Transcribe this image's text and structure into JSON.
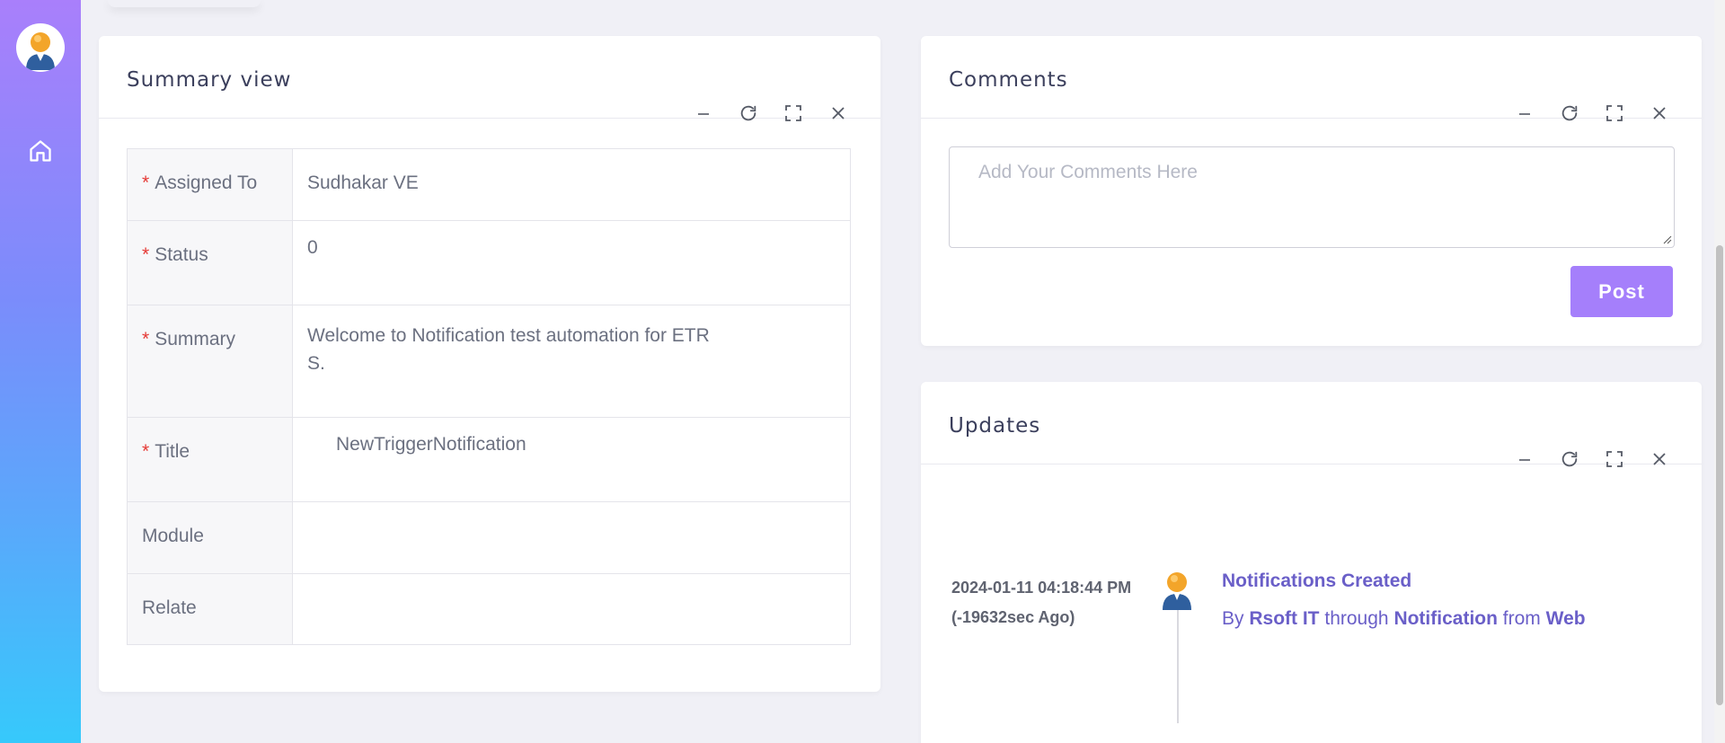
{
  "sidebar": {
    "avatar_icon": "user-avatar-icon",
    "nav": [
      {
        "icon": "home-icon"
      }
    ]
  },
  "summary": {
    "title": "Summary view",
    "fields": [
      {
        "label": "Assigned To",
        "required": true,
        "value": "Sudhakar VE"
      },
      {
        "label": "Status",
        "required": true,
        "value": "0"
      },
      {
        "label": "Summary",
        "required": true,
        "value_line1": "Welcome to Notification test automation for ETR",
        "value_line2": "S."
      },
      {
        "label": "Title",
        "required": true,
        "value": "NewTriggerNotification"
      },
      {
        "label": "Module",
        "required": false,
        "value": ""
      },
      {
        "label": "Relate",
        "required": false,
        "value": ""
      }
    ],
    "required_mark": "*"
  },
  "comments": {
    "title": "Comments",
    "placeholder": "Add Your Comments Here",
    "post_label": "Post"
  },
  "updates": {
    "title": "Updates",
    "entry": {
      "timestamp": "2024-01-11 04:18:44 PM",
      "ago": "(-19632sec Ago)",
      "headline": "Notifications Created",
      "by_prefix": "By",
      "by_user": "Rsoft IT",
      "through_word": "through",
      "through_value": "Notification",
      "from_word": "from",
      "from_value": "Web"
    }
  },
  "colors": {
    "accent": "#a57ffb",
    "link": "#6a5fc8",
    "required": "#e53935"
  }
}
